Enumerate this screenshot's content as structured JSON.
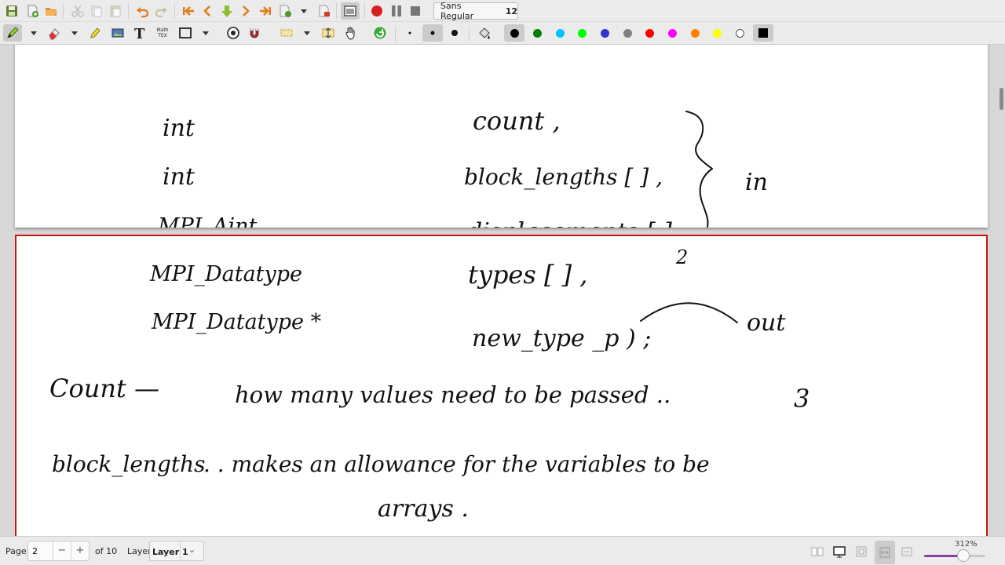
{
  "toolbar_top": {
    "buttons": [
      "save-icon",
      "new-page-icon",
      "open-icon",
      "cut-icon",
      "copy-icon",
      "paste-icon",
      "undo-icon",
      "redo-icon",
      "first-page-icon",
      "prev-page-icon",
      "goto-page-icon",
      "next-page-icon",
      "last-page-icon",
      "new-page-after-icon",
      "delete-page-icon",
      "fullscreen-icon",
      "record-icon",
      "pause-icon",
      "stop-icon"
    ],
    "font_name": "Sans Regular",
    "font_size": "12"
  },
  "toolbar_tools": {
    "tools": [
      "pen-icon",
      "eraser-icon",
      "highlighter-icon",
      "image-icon",
      "text-tool-icon",
      "math-tex-icon",
      "rectangle-icon",
      "shape-recognizer-icon",
      "ruler-magnet-icon",
      "select-region-icon",
      "vertical-space-icon",
      "hand-icon",
      "default-tools-icon"
    ],
    "math_tex_label": [
      "Math",
      "TEX"
    ],
    "thickness": [
      "fine",
      "medium",
      "thick"
    ],
    "colors": [
      "#000000",
      "#008000",
      "#00c0ff",
      "#00ff00",
      "#3333cc",
      "#808080",
      "#ff0000",
      "#ff00ff",
      "#ff8000",
      "#ffff00",
      "#ffffff",
      "#000000"
    ]
  },
  "page1": {
    "lines": [
      {
        "type": "int",
        "name": "count ,"
      },
      {
        "type": "int",
        "name": "block_lengths [ ] ,"
      },
      {
        "type": "MPI_Aint",
        "name": "displacements [ ] ,"
      }
    ],
    "brace_label": "in"
  },
  "page2": {
    "lines": [
      {
        "type": "MPI_Datatype",
        "name": "types [ ] ,"
      },
      {
        "type": "MPI_Datatype *",
        "name": "new_type _p ) ;"
      }
    ],
    "mark_2": "2",
    "out_label": "out",
    "note1": {
      "term": "Count —",
      "text": "how many values need to be passed ..",
      "value": "3"
    },
    "note2": {
      "term": "block_lengths",
      "text": ". . makes an allowance for the variables to be",
      "cont": "arrays ."
    }
  },
  "statusbar": {
    "page_label": "Page",
    "page_value": "2",
    "minus": "−",
    "plus": "+",
    "of_pages": "of 10",
    "layer_label": "Layer",
    "layer_value": "Layer 1",
    "zoom": "312%",
    "zoom_fraction": 0.64
  }
}
